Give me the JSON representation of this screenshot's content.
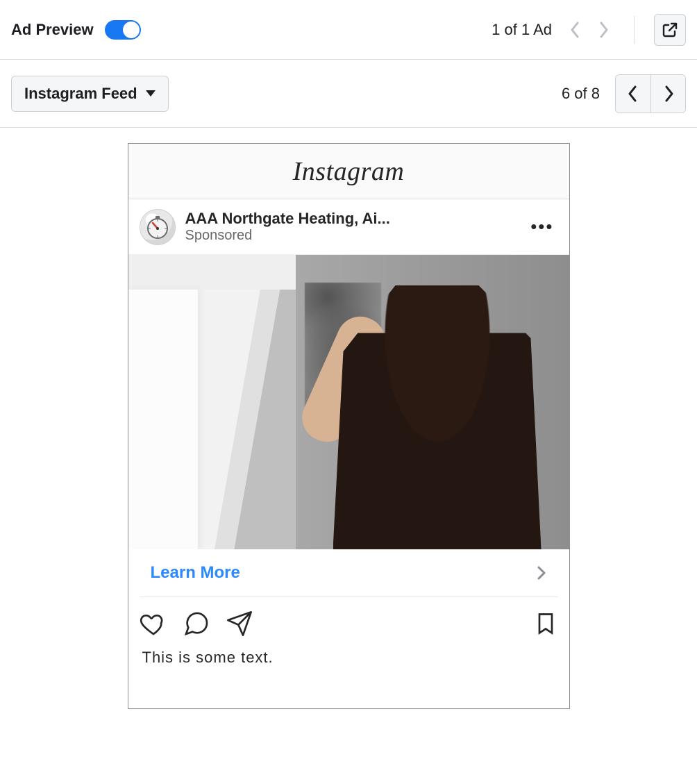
{
  "header": {
    "title": "Ad Preview",
    "toggle_on": true,
    "ad_count_label": "1 of 1 Ad"
  },
  "secondary": {
    "placement_label": "Instagram Feed",
    "page_count_label": "6 of 8"
  },
  "preview": {
    "platform_label": "Instagram",
    "advertiser_name": "AAA Northgate Heating, Ai...",
    "sponsored_label": "Sponsored",
    "cta_label": "Learn More",
    "caption_text": "This is some text."
  }
}
